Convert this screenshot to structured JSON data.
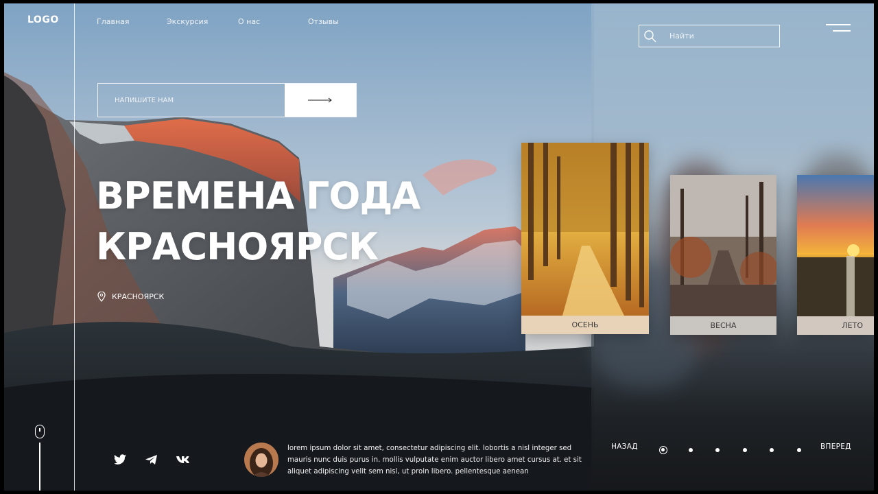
{
  "header": {
    "logo": "LOGO",
    "nav": [
      "Главная",
      "Экскурсия",
      "О нас",
      "Отзывы"
    ],
    "search_placeholder": "Найти"
  },
  "contact": {
    "placeholder": "НАПИШИТЕ НАМ",
    "send_icon": "arrow-right-icon"
  },
  "hero": {
    "title_line1": "ВРЕМЕНА ГОДА",
    "title_line2": "КРАСНОЯРСК",
    "location": "КРАСНОЯРСК"
  },
  "seasons": [
    {
      "label": "ОСЕНЬ"
    },
    {
      "label": "ВЕСНА"
    },
    {
      "label": "ЛЕТО"
    }
  ],
  "social": [
    "twitter-icon",
    "telegram-icon",
    "vk-icon"
  ],
  "review": {
    "text": "lorem ipsum dolor sit amet, consectetur adipiscing elit. lobortis a nisl integer sed mauris nunc duis purus in. mollis vulputate enim auctor libero amet cursus at. et sit aliquet adipiscing velit sem nisl, ut proin libero. pellentesque aenean"
  },
  "pager": {
    "prev": "НАЗАД",
    "next": "ВПЕРЕД",
    "total": 6,
    "current": 1
  },
  "colors": {
    "text": "#ffffff",
    "card_label_bg_autumn": "#e8d3b8",
    "card_label_bg_spring": "#c9c5c1",
    "card_label_bg_summer": "#d2c8c0"
  }
}
